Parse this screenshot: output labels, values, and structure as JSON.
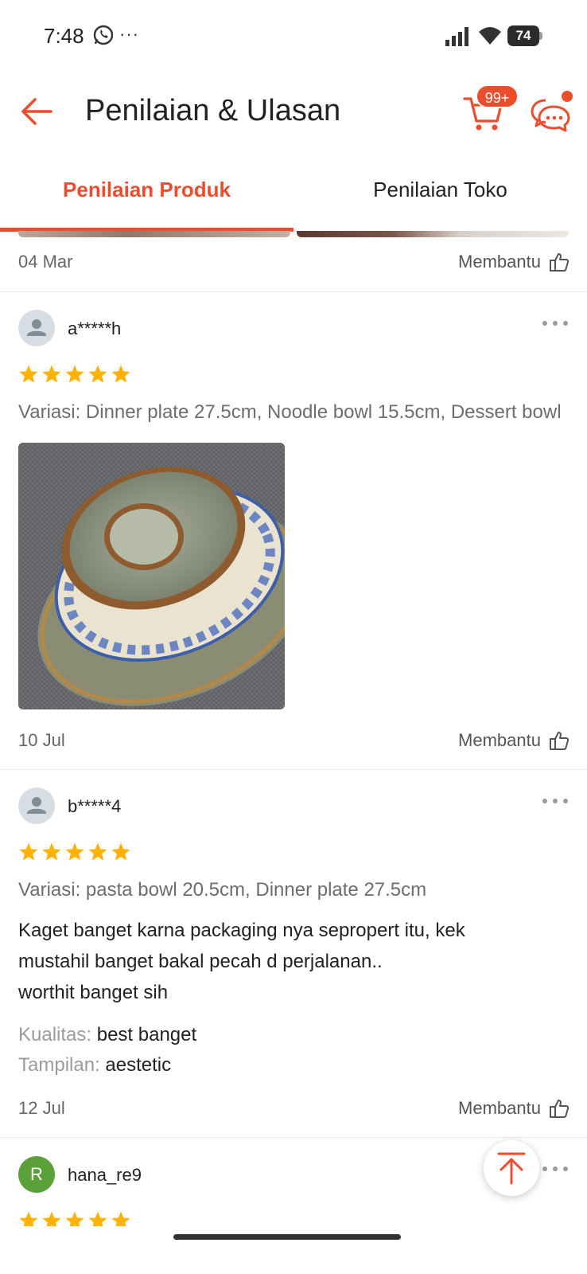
{
  "status_bar": {
    "time": "7:48",
    "dots": "···",
    "battery": "74",
    "icons": [
      "whatsapp-icon",
      "cellular-signal-icon",
      "wifi-icon",
      "battery-icon"
    ]
  },
  "header": {
    "title": "Penilaian & Ulasan",
    "cart_badge": "99+",
    "accent_color": "#ee4d2d"
  },
  "tabs": [
    {
      "label": "Penilaian Produk",
      "active": true
    },
    {
      "label": "Penilaian Toko",
      "active": false
    }
  ],
  "reviews": [
    {
      "date": "04 Mar",
      "helpful_label": "Membantu"
    },
    {
      "username": "a*****h",
      "rating": 5,
      "variation": "Variasi: Dinner plate 27.5cm, Noodle bowl 15.5cm, Dessert bowl",
      "date": "10 Jul",
      "helpful_label": "Membantu"
    },
    {
      "username": "b*****4",
      "rating": 5,
      "variation": "Variasi: pasta bowl 20.5cm, Dinner plate 27.5cm",
      "text_lines": [
        "Kaget banget karna packaging nya sepropert itu, kek",
        "mustahil banget bakal pecah d perjalanan..",
        "worthit banget sih"
      ],
      "attributes": [
        {
          "label": "Kualitas:",
          "value": "best banget"
        },
        {
          "label": "Tampilan:",
          "value": "aestetic"
        }
      ],
      "date": "12 Jul",
      "helpful_label": "Membantu"
    },
    {
      "username": "hana_re9",
      "avatar_letter": "R",
      "rating": 5
    }
  ]
}
